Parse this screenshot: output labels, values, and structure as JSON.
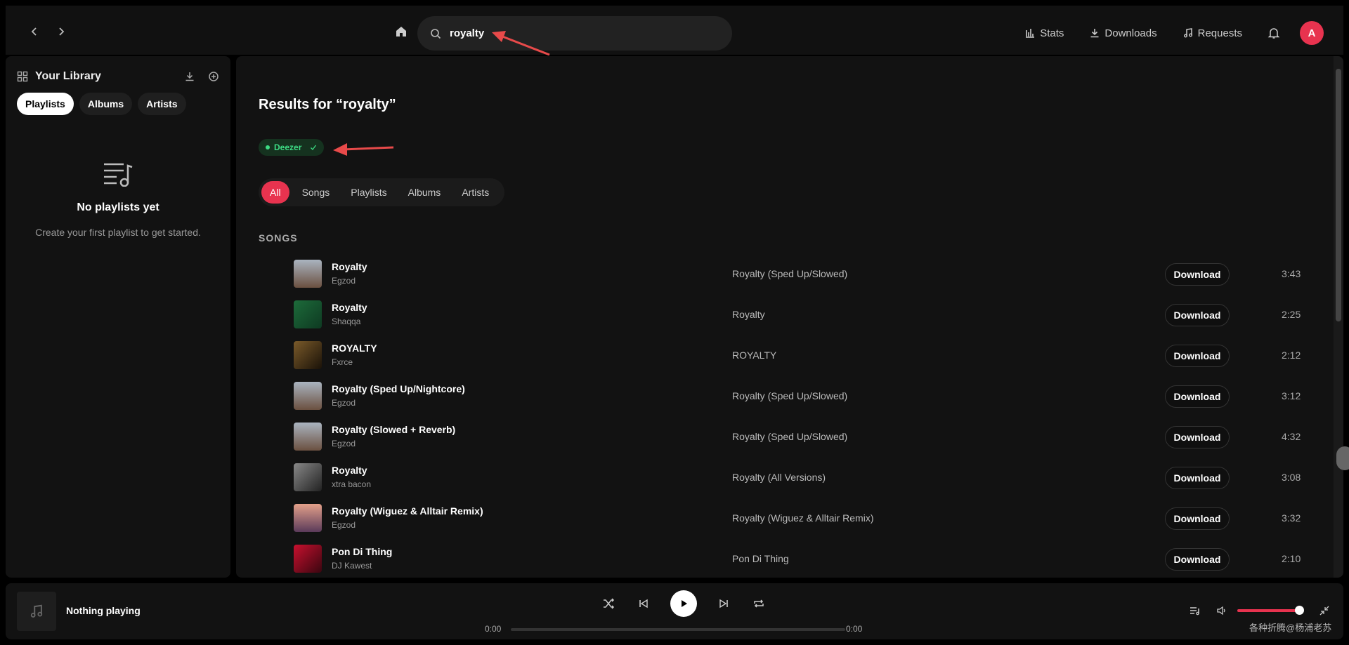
{
  "topbar": {
    "search_value": "royalty",
    "links": [
      {
        "label": "Stats",
        "icon": "stats-icon"
      },
      {
        "label": "Downloads",
        "icon": "download-icon"
      },
      {
        "label": "Requests",
        "icon": "music-note-icon"
      }
    ],
    "avatar_letter": "A"
  },
  "sidebar": {
    "title": "Your Library",
    "tabs": [
      "Playlists",
      "Albums",
      "Artists"
    ],
    "empty_title": "No playlists yet",
    "empty_subtitle": "Create your first playlist to get started."
  },
  "main": {
    "results_title": "Results for “royalty”",
    "source_badge": "Deezer",
    "filters": [
      "All",
      "Songs",
      "Playlists",
      "Albums",
      "Artists"
    ],
    "section_label": "SONGS",
    "download_label": "Download",
    "songs": [
      {
        "title": "Royalty",
        "artist": "Egzod",
        "album": "Royalty (Sped Up/Slowed)",
        "duration": "3:43"
      },
      {
        "title": "Royalty",
        "artist": "Shaqqa",
        "album": "Royalty",
        "duration": "2:25"
      },
      {
        "title": "ROYALTY",
        "artist": "Fxrce",
        "album": "ROYALTY",
        "duration": "2:12"
      },
      {
        "title": "Royalty (Sped Up/Nightcore)",
        "artist": "Egzod",
        "album": "Royalty (Sped Up/Slowed)",
        "duration": "3:12"
      },
      {
        "title": "Royalty (Slowed + Reverb)",
        "artist": "Egzod",
        "album": "Royalty (Sped Up/Slowed)",
        "duration": "4:32"
      },
      {
        "title": "Royalty",
        "artist": "xtra bacon",
        "album": "Royalty (All Versions)",
        "duration": "3:08"
      },
      {
        "title": "Royalty (Wiguez & Alltair Remix)",
        "artist": "Egzod",
        "album": "Royalty (Wiguez & Alltair Remix)",
        "duration": "3:32"
      },
      {
        "title": "Pon Di Thing",
        "artist": "DJ Kawest",
        "album": "Pon Di Thing",
        "duration": "2:10"
      }
    ]
  },
  "player": {
    "now_playing": "Nothing playing",
    "elapsed": "0:00",
    "total": "0:00",
    "volume_fraction": 0.92
  },
  "watermark": "各种折腾@杨浦老苏",
  "colors": {
    "accent": "#e8334f",
    "source_green": "#3ddc84",
    "background": "#121212"
  }
}
